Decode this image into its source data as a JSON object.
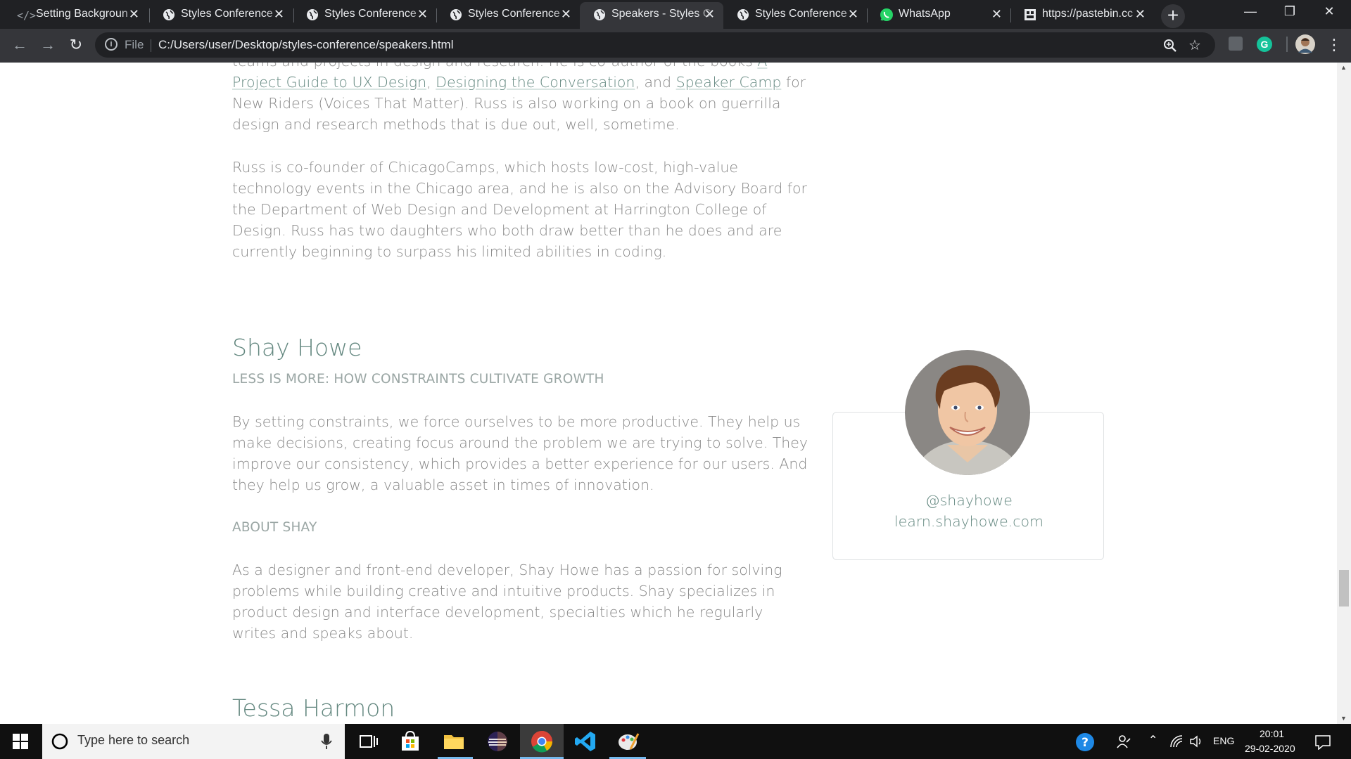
{
  "browser": {
    "tabs": [
      {
        "label": "Setting Backgroun",
        "icon": "code-icon",
        "active": false
      },
      {
        "label": "Styles Conference",
        "icon": "globe-icon",
        "active": false
      },
      {
        "label": "Styles Conference",
        "icon": "globe-icon",
        "active": false
      },
      {
        "label": "Styles Conference",
        "icon": "globe-icon",
        "active": false
      },
      {
        "label": "Speakers - Styles C",
        "icon": "globe-icon",
        "active": true
      },
      {
        "label": "Styles Conference",
        "icon": "globe-icon",
        "active": false
      },
      {
        "label": "WhatsApp",
        "icon": "whatsapp-icon",
        "active": false
      },
      {
        "label": "https://pastebin.cc",
        "icon": "pastebin-icon",
        "active": false
      }
    ],
    "address": {
      "scheme_label": "File",
      "url": "C:/Users/user/Desktop/styles-conference/speakers.html"
    }
  },
  "page": {
    "prev_bio": {
      "line1": "teams and projects in design and research. He is co-author of the books",
      "book1": "A Project Guide to UX Design",
      "book2": "Designing the Conversation",
      "and": ", and",
      "book3": "Speaker Camp",
      "rest": "for New Riders (Voices That Matter). Russ is also working on a book on guerrilla design and research methods that is due out, well, sometime.",
      "para2": "Russ is co-founder of ChicagoCamps, which hosts low-cost, high-value technology events in the Chicago area, and he is also on the Advisory Board for the Department of Web Design and Development at Harrington College of Design. Russ has two daughters who both draw better than he does and are currently beginning to surpass his limited abilities in coding."
    },
    "speaker": {
      "name": "Shay Howe",
      "talk_title": "LESS IS MORE: HOW CONSTRAINTS CULTIVATE GROWTH",
      "talk_description": "By setting constraints, we force ourselves to be more productive. They help us make decisions, creating focus around the problem we are trying to solve. They improve our consistency, which provides a better experience for our users. And they help us grow, a valuable asset in times of innovation.",
      "about_heading": "ABOUT SHAY",
      "about_text": "As a designer and front-end developer, Shay Howe has a passion for solving problems while building creative and intuitive products. Shay specializes in product design and interface development, specialties which he regularly writes and speaks about.",
      "twitter": "@shayhowe",
      "website": "learn.shayhowe.com"
    },
    "next_speaker": {
      "name": "Tessa Harmon"
    }
  },
  "taskbar": {
    "search_placeholder": "Type here to search",
    "language": "ENG",
    "time": "20:01",
    "date": "29-02-2020"
  },
  "colors": {
    "accent": "#648880",
    "text": "#888888",
    "chrome_dark": "#202124",
    "taskbar": "#101010"
  }
}
